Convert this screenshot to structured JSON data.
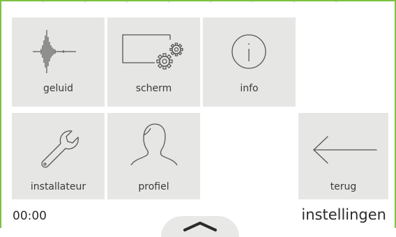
{
  "screen": {
    "title": "instellingen",
    "clock": "00:00"
  },
  "tiles": [
    {
      "id": "geluid",
      "label": "geluid",
      "icon": "sound-wave-icon"
    },
    {
      "id": "scherm",
      "label": "scherm",
      "icon": "screen-settings-icon"
    },
    {
      "id": "info",
      "label": "info",
      "icon": "info-icon"
    },
    {
      "id": "installateur",
      "label": "installateur",
      "icon": "wrench-icon"
    },
    {
      "id": "profiel",
      "label": "profiel",
      "icon": "user-profile-icon"
    },
    {
      "id": "terug",
      "label": "terug",
      "icon": "arrow-left-icon"
    }
  ],
  "colors": {
    "accent_border": "#7cc242",
    "tile_background": "#e6e6e4",
    "text": "#333333"
  },
  "bottom_handle": {
    "icon": "chevron-up-icon"
  }
}
